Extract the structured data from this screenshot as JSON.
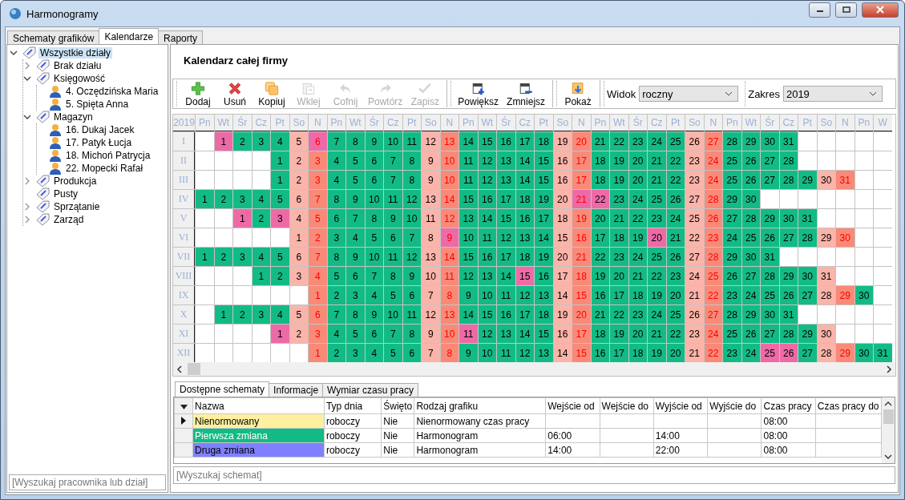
{
  "window": {
    "title": "Harmonogramy"
  },
  "tabs": [
    {
      "label": "Schematy grafików",
      "selected": false
    },
    {
      "label": "Kalendarze",
      "selected": true
    },
    {
      "label": "Raporty",
      "selected": false
    }
  ],
  "tree": [
    {
      "label": "Wszystkie działy",
      "kind": "department",
      "expanded": true,
      "selected": true,
      "children": [
        {
          "label": "Brak działu",
          "kind": "department",
          "expanded": false,
          "selected": false
        },
        {
          "label": "Księgowość",
          "kind": "department",
          "expanded": true,
          "selected": false,
          "children": [
            {
              "label": "4. Oczędzińska Maria",
              "kind": "person",
              "selected": false
            },
            {
              "label": "5. Spięta Anna",
              "kind": "person",
              "selected": false
            }
          ]
        },
        {
          "label": "Magazyn",
          "kind": "department",
          "expanded": true,
          "selected": false,
          "children": [
            {
              "label": "16. Dukaj Jacek",
              "kind": "person",
              "selected": false
            },
            {
              "label": "17. Patyk Łucja",
              "kind": "person",
              "selected": false
            },
            {
              "label": "18. Michoń Patrycja",
              "kind": "person",
              "selected": false
            },
            {
              "label": "22. Mopecki Rafał",
              "kind": "person",
              "selected": false
            }
          ]
        },
        {
          "label": "Produkcja",
          "kind": "department",
          "expanded": false,
          "selected": false
        },
        {
          "label": "Pusty",
          "kind": "department",
          "selected": false
        },
        {
          "label": "Sprzątanie",
          "kind": "department",
          "expanded": false,
          "selected": false
        },
        {
          "label": "Zarząd",
          "kind": "department",
          "expanded": false,
          "selected": false
        }
      ]
    }
  ],
  "tree_search": {
    "placeholder": "[Wyszukaj pracownika lub dział]"
  },
  "heading": "Kalendarz całej firmy",
  "toolbar": {
    "groups": [
      [
        {
          "label": "Dodaj",
          "disabled": false
        },
        {
          "label": "Usuń",
          "disabled": false
        },
        {
          "label": "Kopiuj",
          "disabled": false
        },
        {
          "label": "Wklej",
          "disabled": true
        },
        {
          "label": "Cofnij",
          "disabled": true
        },
        {
          "label": "Powtórz",
          "disabled": true
        },
        {
          "label": "Zapisz",
          "disabled": true
        }
      ],
      [
        {
          "label": "Powiększ",
          "disabled": false
        },
        {
          "label": "Zmniejsz",
          "disabled": false
        }
      ],
      [
        {
          "label": "Pokaż",
          "disabled": false
        }
      ]
    ],
    "combos": [
      {
        "label": "Widok",
        "value": "roczny"
      },
      {
        "label": "Zakres",
        "value": "2019"
      }
    ]
  },
  "calendar": {
    "year": "2019",
    "weekdays": [
      "Pn",
      "Wt",
      "Śr",
      "Cz",
      "Pt",
      "So",
      "N",
      "Pn",
      "Wt",
      "Śr",
      "Cz",
      "Pt",
      "So",
      "N",
      "Pn",
      "Wt",
      "Śr",
      "Cz",
      "Pt",
      "So",
      "N",
      "Pn",
      "Wt",
      "Śr",
      "Cz",
      "Pt",
      "So",
      "N",
      "Pn",
      "Wt",
      "Śr",
      "Cz",
      "Pt",
      "So",
      "N",
      "Pn",
      "W"
    ],
    "months": [
      {
        "label": "I",
        "cells": [
          {
            "kind": "empty"
          },
          {
            "day": "1",
            "kind": "hol"
          },
          {
            "day": "2",
            "kind": "work"
          },
          {
            "day": "3",
            "kind": "work"
          },
          {
            "day": "4",
            "kind": "work"
          },
          {
            "day": "5",
            "kind": "sat"
          },
          {
            "day": "6",
            "kind": "holsun"
          },
          {
            "day": "7",
            "kind": "work"
          },
          {
            "day": "8",
            "kind": "work"
          },
          {
            "day": "9",
            "kind": "work"
          },
          {
            "day": "10",
            "kind": "work"
          },
          {
            "day": "11",
            "kind": "work"
          },
          {
            "day": "12",
            "kind": "sat"
          },
          {
            "day": "13",
            "kind": "sun"
          },
          {
            "day": "14",
            "kind": "work"
          },
          {
            "day": "15",
            "kind": "work"
          },
          {
            "day": "16",
            "kind": "work"
          },
          {
            "day": "17",
            "kind": "work"
          },
          {
            "day": "18",
            "kind": "work"
          },
          {
            "day": "19",
            "kind": "sat"
          },
          {
            "day": "20",
            "kind": "sun"
          },
          {
            "day": "21",
            "kind": "work"
          },
          {
            "day": "22",
            "kind": "work"
          },
          {
            "day": "23",
            "kind": "work"
          },
          {
            "day": "24",
            "kind": "work"
          },
          {
            "day": "25",
            "kind": "work"
          },
          {
            "day": "26",
            "kind": "sat"
          },
          {
            "day": "27",
            "kind": "sun"
          },
          {
            "day": "28",
            "kind": "work"
          },
          {
            "day": "29",
            "kind": "work"
          },
          {
            "day": "30",
            "kind": "work"
          },
          {
            "day": "31",
            "kind": "work"
          },
          {
            "kind": "empty"
          },
          {
            "kind": "empty"
          },
          {
            "kind": "empty"
          },
          {
            "kind": "empty"
          },
          {
            "kind": "empty"
          }
        ]
      },
      {
        "label": "II",
        "cells": [
          {
            "kind": "empty"
          },
          {
            "kind": "empty"
          },
          {
            "kind": "empty"
          },
          {
            "kind": "empty"
          },
          {
            "day": "1",
            "kind": "work"
          },
          {
            "day": "2",
            "kind": "sat"
          },
          {
            "day": "3",
            "kind": "sun"
          },
          {
            "day": "4",
            "kind": "work"
          },
          {
            "day": "5",
            "kind": "work"
          },
          {
            "day": "6",
            "kind": "work"
          },
          {
            "day": "7",
            "kind": "work"
          },
          {
            "day": "8",
            "kind": "work"
          },
          {
            "day": "9",
            "kind": "sat"
          },
          {
            "day": "10",
            "kind": "sun"
          },
          {
            "day": "11",
            "kind": "work"
          },
          {
            "day": "12",
            "kind": "work"
          },
          {
            "day": "13",
            "kind": "work"
          },
          {
            "day": "14",
            "kind": "work"
          },
          {
            "day": "15",
            "kind": "work"
          },
          {
            "day": "16",
            "kind": "sat"
          },
          {
            "day": "17",
            "kind": "sun"
          },
          {
            "day": "18",
            "kind": "work"
          },
          {
            "day": "19",
            "kind": "work"
          },
          {
            "day": "20",
            "kind": "work"
          },
          {
            "day": "21",
            "kind": "work"
          },
          {
            "day": "22",
            "kind": "work"
          },
          {
            "day": "23",
            "kind": "sat"
          },
          {
            "day": "24",
            "kind": "sun"
          },
          {
            "day": "25",
            "kind": "work"
          },
          {
            "day": "26",
            "kind": "work"
          },
          {
            "day": "27",
            "kind": "work"
          },
          {
            "day": "28",
            "kind": "work"
          },
          {
            "kind": "empty"
          },
          {
            "kind": "empty"
          },
          {
            "kind": "empty"
          },
          {
            "kind": "empty"
          },
          {
            "kind": "empty"
          }
        ]
      },
      {
        "label": "III",
        "cells": [
          {
            "kind": "empty"
          },
          {
            "kind": "empty"
          },
          {
            "kind": "empty"
          },
          {
            "kind": "empty"
          },
          {
            "day": "1",
            "kind": "work"
          },
          {
            "day": "2",
            "kind": "sat"
          },
          {
            "day": "3",
            "kind": "sun"
          },
          {
            "day": "4",
            "kind": "work"
          },
          {
            "day": "5",
            "kind": "work"
          },
          {
            "day": "6",
            "kind": "work"
          },
          {
            "day": "7",
            "kind": "work"
          },
          {
            "day": "8",
            "kind": "work"
          },
          {
            "day": "9",
            "kind": "sat"
          },
          {
            "day": "10",
            "kind": "sun"
          },
          {
            "day": "11",
            "kind": "work"
          },
          {
            "day": "12",
            "kind": "work"
          },
          {
            "day": "13",
            "kind": "work"
          },
          {
            "day": "14",
            "kind": "work"
          },
          {
            "day": "15",
            "kind": "work"
          },
          {
            "day": "16",
            "kind": "sat"
          },
          {
            "day": "17",
            "kind": "sun"
          },
          {
            "day": "18",
            "kind": "work"
          },
          {
            "day": "19",
            "kind": "work"
          },
          {
            "day": "20",
            "kind": "work"
          },
          {
            "day": "21",
            "kind": "work"
          },
          {
            "day": "22",
            "kind": "work"
          },
          {
            "day": "23",
            "kind": "sat"
          },
          {
            "day": "24",
            "kind": "sun"
          },
          {
            "day": "25",
            "kind": "work"
          },
          {
            "day": "26",
            "kind": "work"
          },
          {
            "day": "27",
            "kind": "work"
          },
          {
            "day": "28",
            "kind": "work"
          },
          {
            "day": "29",
            "kind": "work"
          },
          {
            "day": "30",
            "kind": "sat"
          },
          {
            "day": "31",
            "kind": "sun"
          },
          {
            "kind": "empty"
          },
          {
            "kind": "empty"
          }
        ]
      },
      {
        "label": "IV",
        "cells": [
          {
            "day": "1",
            "kind": "work"
          },
          {
            "day": "2",
            "kind": "work"
          },
          {
            "day": "3",
            "kind": "work"
          },
          {
            "day": "4",
            "kind": "work"
          },
          {
            "day": "5",
            "kind": "work"
          },
          {
            "day": "6",
            "kind": "sat"
          },
          {
            "day": "7",
            "kind": "sun"
          },
          {
            "day": "8",
            "kind": "work"
          },
          {
            "day": "9",
            "kind": "work"
          },
          {
            "day": "10",
            "kind": "work"
          },
          {
            "day": "11",
            "kind": "work"
          },
          {
            "day": "12",
            "kind": "work"
          },
          {
            "day": "13",
            "kind": "sat"
          },
          {
            "day": "14",
            "kind": "sun"
          },
          {
            "day": "15",
            "kind": "work"
          },
          {
            "day": "16",
            "kind": "work"
          },
          {
            "day": "17",
            "kind": "work"
          },
          {
            "day": "18",
            "kind": "work"
          },
          {
            "day": "19",
            "kind": "work"
          },
          {
            "day": "20",
            "kind": "sat"
          },
          {
            "day": "21",
            "kind": "holsun"
          },
          {
            "day": "22",
            "kind": "hol"
          },
          {
            "day": "23",
            "kind": "work"
          },
          {
            "day": "24",
            "kind": "work"
          },
          {
            "day": "25",
            "kind": "work"
          },
          {
            "day": "26",
            "kind": "work"
          },
          {
            "day": "27",
            "kind": "sat"
          },
          {
            "day": "28",
            "kind": "sun"
          },
          {
            "day": "29",
            "kind": "work"
          },
          {
            "day": "30",
            "kind": "work"
          },
          {
            "kind": "empty"
          },
          {
            "kind": "empty"
          },
          {
            "kind": "empty"
          },
          {
            "kind": "empty"
          },
          {
            "kind": "empty"
          },
          {
            "kind": "empty"
          },
          {
            "kind": "empty"
          }
        ]
      },
      {
        "label": "V",
        "cells": [
          {
            "kind": "empty"
          },
          {
            "kind": "empty"
          },
          {
            "day": "1",
            "kind": "hol"
          },
          {
            "day": "2",
            "kind": "work"
          },
          {
            "day": "3",
            "kind": "hol"
          },
          {
            "day": "4",
            "kind": "sat"
          },
          {
            "day": "5",
            "kind": "sun"
          },
          {
            "day": "6",
            "kind": "work"
          },
          {
            "day": "7",
            "kind": "work"
          },
          {
            "day": "8",
            "kind": "work"
          },
          {
            "day": "9",
            "kind": "work"
          },
          {
            "day": "10",
            "kind": "work"
          },
          {
            "day": "11",
            "kind": "sat"
          },
          {
            "day": "12",
            "kind": "sun"
          },
          {
            "day": "13",
            "kind": "work"
          },
          {
            "day": "14",
            "kind": "work"
          },
          {
            "day": "15",
            "kind": "work"
          },
          {
            "day": "16",
            "kind": "work"
          },
          {
            "day": "17",
            "kind": "work"
          },
          {
            "day": "18",
            "kind": "sat"
          },
          {
            "day": "19",
            "kind": "sun"
          },
          {
            "day": "20",
            "kind": "work"
          },
          {
            "day": "21",
            "kind": "work"
          },
          {
            "day": "22",
            "kind": "work"
          },
          {
            "day": "23",
            "kind": "work"
          },
          {
            "day": "24",
            "kind": "work"
          },
          {
            "day": "25",
            "kind": "sat"
          },
          {
            "day": "26",
            "kind": "sun"
          },
          {
            "day": "27",
            "kind": "work"
          },
          {
            "day": "28",
            "kind": "work"
          },
          {
            "day": "29",
            "kind": "work"
          },
          {
            "day": "30",
            "kind": "work"
          },
          {
            "day": "31",
            "kind": "work"
          },
          {
            "kind": "empty"
          },
          {
            "kind": "empty"
          },
          {
            "kind": "empty"
          },
          {
            "kind": "empty"
          }
        ]
      },
      {
        "label": "VI",
        "cells": [
          {
            "kind": "empty"
          },
          {
            "kind": "empty"
          },
          {
            "kind": "empty"
          },
          {
            "kind": "empty"
          },
          {
            "kind": "empty"
          },
          {
            "day": "1",
            "kind": "sat"
          },
          {
            "day": "2",
            "kind": "sun"
          },
          {
            "day": "3",
            "kind": "work"
          },
          {
            "day": "4",
            "kind": "work"
          },
          {
            "day": "5",
            "kind": "work"
          },
          {
            "day": "6",
            "kind": "work"
          },
          {
            "day": "7",
            "kind": "work"
          },
          {
            "day": "8",
            "kind": "sat"
          },
          {
            "day": "9",
            "kind": "holsun"
          },
          {
            "day": "10",
            "kind": "work"
          },
          {
            "day": "11",
            "kind": "work"
          },
          {
            "day": "12",
            "kind": "work"
          },
          {
            "day": "13",
            "kind": "work"
          },
          {
            "day": "14",
            "kind": "work"
          },
          {
            "day": "15",
            "kind": "sat"
          },
          {
            "day": "16",
            "kind": "sun"
          },
          {
            "day": "17",
            "kind": "work"
          },
          {
            "day": "18",
            "kind": "work"
          },
          {
            "day": "19",
            "kind": "work"
          },
          {
            "day": "20",
            "kind": "hol"
          },
          {
            "day": "21",
            "kind": "work"
          },
          {
            "day": "22",
            "kind": "sat"
          },
          {
            "day": "23",
            "kind": "sun"
          },
          {
            "day": "24",
            "kind": "work"
          },
          {
            "day": "25",
            "kind": "work"
          },
          {
            "day": "26",
            "kind": "work"
          },
          {
            "day": "27",
            "kind": "work"
          },
          {
            "day": "28",
            "kind": "work"
          },
          {
            "day": "29",
            "kind": "sat"
          },
          {
            "day": "30",
            "kind": "sun"
          },
          {
            "kind": "empty"
          },
          {
            "kind": "empty"
          }
        ]
      },
      {
        "label": "VII",
        "cells": [
          {
            "day": "1",
            "kind": "work"
          },
          {
            "day": "2",
            "kind": "work"
          },
          {
            "day": "3",
            "kind": "work"
          },
          {
            "day": "4",
            "kind": "work"
          },
          {
            "day": "5",
            "kind": "work"
          },
          {
            "day": "6",
            "kind": "sat"
          },
          {
            "day": "7",
            "kind": "sun"
          },
          {
            "day": "8",
            "kind": "work"
          },
          {
            "day": "9",
            "kind": "work"
          },
          {
            "day": "10",
            "kind": "work"
          },
          {
            "day": "11",
            "kind": "work"
          },
          {
            "day": "12",
            "kind": "work"
          },
          {
            "day": "13",
            "kind": "sat"
          },
          {
            "day": "14",
            "kind": "sun"
          },
          {
            "day": "15",
            "kind": "work"
          },
          {
            "day": "16",
            "kind": "work"
          },
          {
            "day": "17",
            "kind": "work"
          },
          {
            "day": "18",
            "kind": "work"
          },
          {
            "day": "19",
            "kind": "work"
          },
          {
            "day": "20",
            "kind": "sat"
          },
          {
            "day": "21",
            "kind": "sun"
          },
          {
            "day": "22",
            "kind": "work"
          },
          {
            "day": "23",
            "kind": "work"
          },
          {
            "day": "24",
            "kind": "work"
          },
          {
            "day": "25",
            "kind": "work"
          },
          {
            "day": "26",
            "kind": "work"
          },
          {
            "day": "27",
            "kind": "sat"
          },
          {
            "day": "28",
            "kind": "sun"
          },
          {
            "day": "29",
            "kind": "work"
          },
          {
            "day": "30",
            "kind": "work"
          },
          {
            "day": "31",
            "kind": "work"
          },
          {
            "kind": "empty"
          },
          {
            "kind": "empty"
          },
          {
            "kind": "empty"
          },
          {
            "kind": "empty"
          },
          {
            "kind": "empty"
          },
          {
            "kind": "empty"
          }
        ]
      },
      {
        "label": "VIII",
        "cells": [
          {
            "kind": "empty"
          },
          {
            "kind": "empty"
          },
          {
            "kind": "empty"
          },
          {
            "day": "1",
            "kind": "work"
          },
          {
            "day": "2",
            "kind": "work"
          },
          {
            "day": "3",
            "kind": "sat"
          },
          {
            "day": "4",
            "kind": "sun"
          },
          {
            "day": "5",
            "kind": "work"
          },
          {
            "day": "6",
            "kind": "work"
          },
          {
            "day": "7",
            "kind": "work"
          },
          {
            "day": "8",
            "kind": "work"
          },
          {
            "day": "9",
            "kind": "work"
          },
          {
            "day": "10",
            "kind": "sat"
          },
          {
            "day": "11",
            "kind": "sun"
          },
          {
            "day": "12",
            "kind": "work"
          },
          {
            "day": "13",
            "kind": "work"
          },
          {
            "day": "14",
            "kind": "work"
          },
          {
            "day": "15",
            "kind": "hol"
          },
          {
            "day": "16",
            "kind": "work"
          },
          {
            "day": "17",
            "kind": "sat"
          },
          {
            "day": "18",
            "kind": "sun"
          },
          {
            "day": "19",
            "kind": "work"
          },
          {
            "day": "20",
            "kind": "work"
          },
          {
            "day": "21",
            "kind": "work"
          },
          {
            "day": "22",
            "kind": "work"
          },
          {
            "day": "23",
            "kind": "work"
          },
          {
            "day": "24",
            "kind": "sat"
          },
          {
            "day": "25",
            "kind": "sun"
          },
          {
            "day": "26",
            "kind": "work"
          },
          {
            "day": "27",
            "kind": "work"
          },
          {
            "day": "28",
            "kind": "work"
          },
          {
            "day": "29",
            "kind": "work"
          },
          {
            "day": "30",
            "kind": "work"
          },
          {
            "day": "31",
            "kind": "sat"
          },
          {
            "kind": "empty"
          },
          {
            "kind": "empty"
          },
          {
            "kind": "empty"
          }
        ]
      },
      {
        "label": "IX",
        "cells": [
          {
            "kind": "empty"
          },
          {
            "kind": "empty"
          },
          {
            "kind": "empty"
          },
          {
            "kind": "empty"
          },
          {
            "kind": "empty"
          },
          {
            "kind": "empty"
          },
          {
            "day": "1",
            "kind": "sun"
          },
          {
            "day": "2",
            "kind": "work"
          },
          {
            "day": "3",
            "kind": "work"
          },
          {
            "day": "4",
            "kind": "work"
          },
          {
            "day": "5",
            "kind": "work"
          },
          {
            "day": "6",
            "kind": "work"
          },
          {
            "day": "7",
            "kind": "sat"
          },
          {
            "day": "8",
            "kind": "sun"
          },
          {
            "day": "9",
            "kind": "work"
          },
          {
            "day": "10",
            "kind": "work"
          },
          {
            "day": "11",
            "kind": "work"
          },
          {
            "day": "12",
            "kind": "work"
          },
          {
            "day": "13",
            "kind": "work"
          },
          {
            "day": "14",
            "kind": "sat"
          },
          {
            "day": "15",
            "kind": "sun"
          },
          {
            "day": "16",
            "kind": "work"
          },
          {
            "day": "17",
            "kind": "work"
          },
          {
            "day": "18",
            "kind": "work"
          },
          {
            "day": "19",
            "kind": "work"
          },
          {
            "day": "20",
            "kind": "work"
          },
          {
            "day": "21",
            "kind": "sat"
          },
          {
            "day": "22",
            "kind": "sun"
          },
          {
            "day": "23",
            "kind": "work"
          },
          {
            "day": "24",
            "kind": "work"
          },
          {
            "day": "25",
            "kind": "work"
          },
          {
            "day": "26",
            "kind": "work"
          },
          {
            "day": "27",
            "kind": "work"
          },
          {
            "day": "28",
            "kind": "sat"
          },
          {
            "day": "29",
            "kind": "sun"
          },
          {
            "day": "30",
            "kind": "work"
          },
          {
            "kind": "empty"
          }
        ]
      },
      {
        "label": "X",
        "cells": [
          {
            "kind": "empty"
          },
          {
            "day": "1",
            "kind": "work"
          },
          {
            "day": "2",
            "kind": "work"
          },
          {
            "day": "3",
            "kind": "work"
          },
          {
            "day": "4",
            "kind": "work"
          },
          {
            "day": "5",
            "kind": "sat"
          },
          {
            "day": "6",
            "kind": "sun"
          },
          {
            "day": "7",
            "kind": "work"
          },
          {
            "day": "8",
            "kind": "work"
          },
          {
            "day": "9",
            "kind": "work"
          },
          {
            "day": "10",
            "kind": "work"
          },
          {
            "day": "11",
            "kind": "work"
          },
          {
            "day": "12",
            "kind": "sat"
          },
          {
            "day": "13",
            "kind": "sun"
          },
          {
            "day": "14",
            "kind": "work"
          },
          {
            "day": "15",
            "kind": "work"
          },
          {
            "day": "16",
            "kind": "work"
          },
          {
            "day": "17",
            "kind": "work"
          },
          {
            "day": "18",
            "kind": "work"
          },
          {
            "day": "19",
            "kind": "sat"
          },
          {
            "day": "20",
            "kind": "sun"
          },
          {
            "day": "21",
            "kind": "work"
          },
          {
            "day": "22",
            "kind": "work"
          },
          {
            "day": "23",
            "kind": "work"
          },
          {
            "day": "24",
            "kind": "work"
          },
          {
            "day": "25",
            "kind": "work"
          },
          {
            "day": "26",
            "kind": "sat"
          },
          {
            "day": "27",
            "kind": "sun"
          },
          {
            "day": "28",
            "kind": "work"
          },
          {
            "day": "29",
            "kind": "work"
          },
          {
            "day": "30",
            "kind": "work"
          },
          {
            "day": "31",
            "kind": "work"
          },
          {
            "kind": "empty"
          },
          {
            "kind": "empty"
          },
          {
            "kind": "empty"
          },
          {
            "kind": "empty"
          },
          {
            "kind": "empty"
          }
        ]
      },
      {
        "label": "XI",
        "cells": [
          {
            "kind": "empty"
          },
          {
            "kind": "empty"
          },
          {
            "kind": "empty"
          },
          {
            "kind": "empty"
          },
          {
            "day": "1",
            "kind": "hol"
          },
          {
            "day": "2",
            "kind": "sat"
          },
          {
            "day": "3",
            "kind": "sun"
          },
          {
            "day": "4",
            "kind": "work"
          },
          {
            "day": "5",
            "kind": "work"
          },
          {
            "day": "6",
            "kind": "work"
          },
          {
            "day": "7",
            "kind": "work"
          },
          {
            "day": "8",
            "kind": "work"
          },
          {
            "day": "9",
            "kind": "sat"
          },
          {
            "day": "10",
            "kind": "sun"
          },
          {
            "day": "11",
            "kind": "hol"
          },
          {
            "day": "12",
            "kind": "work"
          },
          {
            "day": "13",
            "kind": "work"
          },
          {
            "day": "14",
            "kind": "work"
          },
          {
            "day": "15",
            "kind": "work"
          },
          {
            "day": "16",
            "kind": "sat"
          },
          {
            "day": "17",
            "kind": "sun"
          },
          {
            "day": "18",
            "kind": "work"
          },
          {
            "day": "19",
            "kind": "work"
          },
          {
            "day": "20",
            "kind": "work"
          },
          {
            "day": "21",
            "kind": "work"
          },
          {
            "day": "22",
            "kind": "work"
          },
          {
            "day": "23",
            "kind": "sat"
          },
          {
            "day": "24",
            "kind": "sun"
          },
          {
            "day": "25",
            "kind": "work"
          },
          {
            "day": "26",
            "kind": "work"
          },
          {
            "day": "27",
            "kind": "work"
          },
          {
            "day": "28",
            "kind": "work"
          },
          {
            "day": "29",
            "kind": "work"
          },
          {
            "day": "30",
            "kind": "sat"
          },
          {
            "kind": "empty"
          },
          {
            "kind": "empty"
          },
          {
            "kind": "empty"
          }
        ]
      },
      {
        "label": "XII",
        "cells": [
          {
            "kind": "empty"
          },
          {
            "kind": "empty"
          },
          {
            "kind": "empty"
          },
          {
            "kind": "empty"
          },
          {
            "kind": "empty"
          },
          {
            "kind": "empty"
          },
          {
            "day": "1",
            "kind": "sun"
          },
          {
            "day": "2",
            "kind": "work"
          },
          {
            "day": "3",
            "kind": "work"
          },
          {
            "day": "4",
            "kind": "work"
          },
          {
            "day": "5",
            "kind": "work"
          },
          {
            "day": "6",
            "kind": "work"
          },
          {
            "day": "7",
            "kind": "sat"
          },
          {
            "day": "8",
            "kind": "sun"
          },
          {
            "day": "9",
            "kind": "work"
          },
          {
            "day": "10",
            "kind": "work"
          },
          {
            "day": "11",
            "kind": "work"
          },
          {
            "day": "12",
            "kind": "work"
          },
          {
            "day": "13",
            "kind": "work"
          },
          {
            "day": "14",
            "kind": "sat"
          },
          {
            "day": "15",
            "kind": "sun"
          },
          {
            "day": "16",
            "kind": "work"
          },
          {
            "day": "17",
            "kind": "work"
          },
          {
            "day": "18",
            "kind": "work"
          },
          {
            "day": "19",
            "kind": "work"
          },
          {
            "day": "20",
            "kind": "work"
          },
          {
            "day": "21",
            "kind": "sat"
          },
          {
            "day": "22",
            "kind": "sun"
          },
          {
            "day": "23",
            "kind": "work"
          },
          {
            "day": "24",
            "kind": "work"
          },
          {
            "day": "25",
            "kind": "hol"
          },
          {
            "day": "26",
            "kind": "hol"
          },
          {
            "day": "27",
            "kind": "work"
          },
          {
            "day": "28",
            "kind": "sat"
          },
          {
            "day": "29",
            "kind": "sun"
          },
          {
            "day": "30",
            "kind": "work"
          },
          {
            "day": "31",
            "kind": "work"
          }
        ]
      }
    ]
  },
  "bottom_tabs": [
    {
      "label": "Dostępne schematy",
      "selected": true
    },
    {
      "label": "Informacje",
      "selected": false
    },
    {
      "label": "Wymiar czasu pracy",
      "selected": false
    }
  ],
  "schemes": {
    "columns": [
      "Nazwa",
      "Typ dnia",
      "Święto",
      "Rodzaj grafiku",
      "Wejście od",
      "Wejście do",
      "Wyjście od",
      "Wyjście do",
      "Czas pracy",
      "Czas pracy do"
    ],
    "rows": [
      {
        "color": "#fff0a0",
        "current": true,
        "cells": [
          "Nienormowany",
          "roboczy",
          "Nie",
          "Nienormowany czas pracy",
          "",
          "",
          "",
          "",
          "08:00",
          ""
        ]
      },
      {
        "color": "#12bb85",
        "current": false,
        "cells": [
          "Pierwsza zmiana",
          "roboczy",
          "Nie",
          "Harmonogram",
          "06:00",
          "",
          "14:00",
          "",
          "08:00",
          ""
        ]
      },
      {
        "color": "#8080ff",
        "current": false,
        "cells": [
          "Druga zmiana",
          "roboczy",
          "Nie",
          "Harmonogram",
          "14:00",
          "",
          "22:00",
          "",
          "08:00",
          ""
        ]
      }
    ]
  },
  "scheme_search": {
    "placeholder": "[Wyszukaj schemat]"
  }
}
